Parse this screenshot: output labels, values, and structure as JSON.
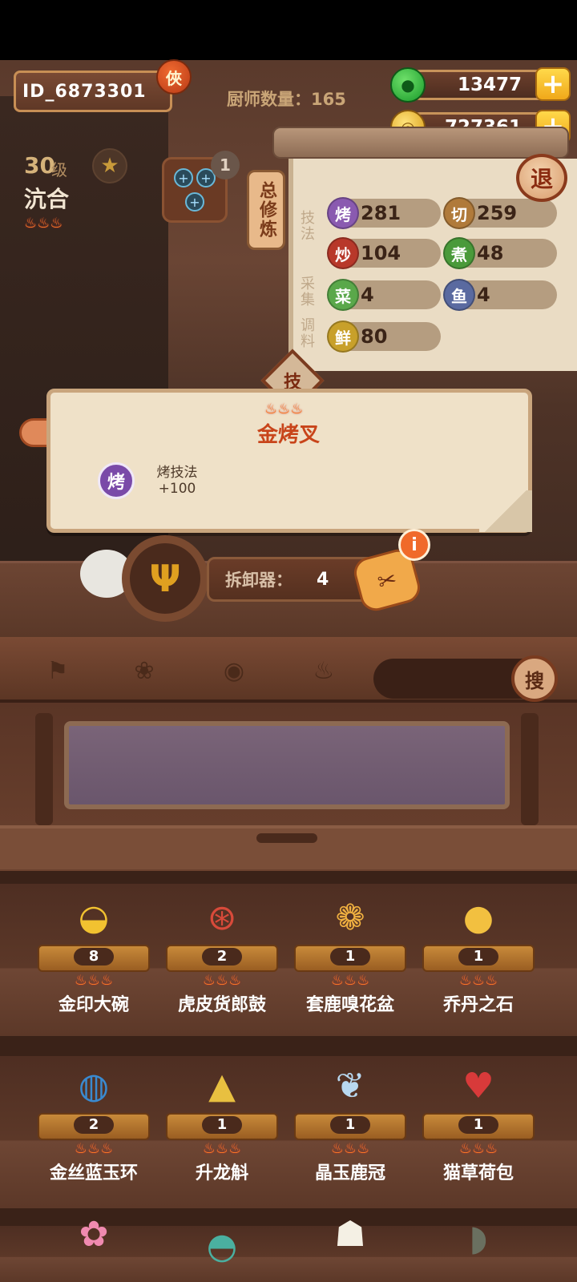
{
  "player": {
    "id": "ID_6873301",
    "badge": "俠",
    "chef_count_label": "厨师数量：165"
  },
  "currency": {
    "jade": "13477",
    "coins": "727361",
    "plus": "+"
  },
  "chef": {
    "level_num": "30",
    "level_suffix": "级",
    "name": "沆合",
    "stars": 3
  },
  "gear": {
    "count": "1",
    "slot_icons": [
      "+",
      "+",
      "+"
    ]
  },
  "panel": {
    "total_train": "总修炼",
    "label_tech": "技法",
    "label_gather": "采集",
    "label_season": "调料",
    "quit": "退",
    "stats": [
      {
        "icon": "烤",
        "value": "281",
        "color": "#8a5ab0"
      },
      {
        "icon": "切",
        "value": "259",
        "color": "#b07a3a"
      },
      {
        "icon": "炒",
        "value": "104",
        "color": "#b8382a"
      },
      {
        "icon": "煮",
        "value": "48",
        "color": "#4a9a3a"
      },
      {
        "icon": "菜",
        "value": "4",
        "color": "#5aa84a"
      },
      {
        "icon": "鱼",
        "value": "4",
        "color": "#5a6aa0"
      },
      {
        "icon": "鲜",
        "value": "80",
        "color": "#c8a02a"
      }
    ]
  },
  "tech_tab": "技",
  "popup": {
    "title": "金烤叉",
    "icon": "烤",
    "attr_name": "烤技法",
    "attr_value": "+100"
  },
  "dismantle": {
    "label": "拆卸器：",
    "value": "4"
  },
  "info": "i",
  "search": {
    "button": "搜"
  },
  "filters": [
    "bone-icon",
    "pot-icon",
    "pan-icon",
    "fire-icon"
  ],
  "items": [
    {
      "name": "金印大碗",
      "count": "8",
      "icon": "bowl-icon"
    },
    {
      "name": "虎皮货郎鼓",
      "count": "2",
      "icon": "drum-icon"
    },
    {
      "name": "套鹿嗅花盆",
      "count": "1",
      "icon": "deer-pot-icon"
    },
    {
      "name": "乔丹之石",
      "count": "1",
      "icon": "stone-icon"
    },
    {
      "name": "金丝蓝玉环",
      "count": "2",
      "icon": "jade-ring-icon"
    },
    {
      "name": "升龙斛",
      "count": "1",
      "icon": "dragon-vessel-icon"
    },
    {
      "name": "晶玉鹿冠",
      "count": "1",
      "icon": "antler-icon"
    },
    {
      "name": "猫草荷包",
      "count": "1",
      "icon": "pouch-icon"
    }
  ],
  "colors": {
    "accent_orange": "#ff7a24",
    "frame_brown": "#c88f55",
    "popup_title": "#c8441a"
  }
}
